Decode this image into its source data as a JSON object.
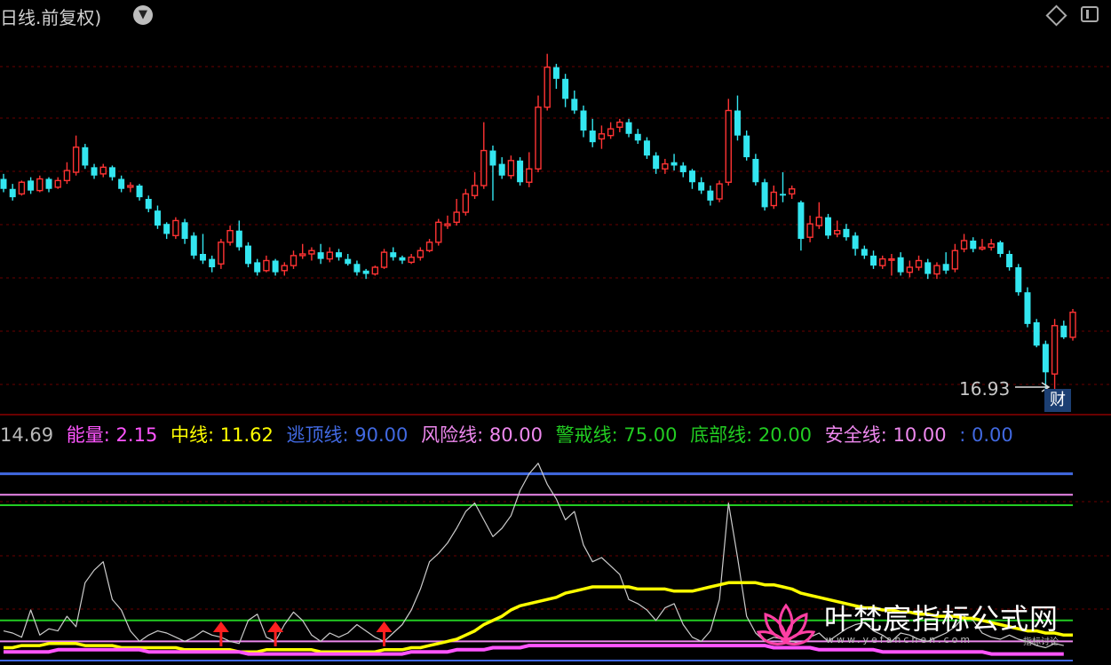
{
  "header": {
    "title": "日线.前复权)",
    "dropdown_icon": "chevron-down-icon"
  },
  "toolbar": {
    "diamond_icon": "diamond-icon",
    "panel_icon": "panel-layout-icon"
  },
  "price": {
    "low_label": "16.93",
    "badge": "财"
  },
  "legend": {
    "scale": "14.69",
    "items": [
      {
        "label": "能量",
        "value": "2.15",
        "color": "#ff55ff"
      },
      {
        "label": "中线",
        "value": "11.62",
        "color": "#ffff00"
      },
      {
        "label": "逃顶线",
        "value": "90.00",
        "color": "#4169e1"
      },
      {
        "label": "风险线",
        "value": "80.00",
        "color": "#ee88ee"
      },
      {
        "label": "警戒线",
        "value": "75.00",
        "color": "#22cc22"
      },
      {
        "label": "底部线",
        "value": "20.00",
        "color": "#22cc22"
      },
      {
        "label": "安全线",
        "value": "10.00",
        "color": "#ee88ee"
      },
      {
        "label": "",
        "value": "0.00",
        "color": "#4169e1"
      }
    ]
  },
  "watermark": {
    "title": "叶梵宸指标公式网",
    "subtitle": "www.yefanchen.com",
    "subtitle2": "指标讨论"
  },
  "chart_data": [
    {
      "type": "candlestick",
      "colors": {
        "up": "#ff3333",
        "down": "#33e6f0"
      },
      "low_marker": 16.93,
      "candles": [
        [
          18.2,
          17.6,
          18.5,
          17.4
        ],
        [
          17.6,
          17.1,
          17.9,
          16.9
        ],
        [
          17.3,
          18.0,
          18.1,
          17.2
        ],
        [
          18.1,
          17.5,
          18.3,
          17.3
        ],
        [
          17.5,
          18.2,
          18.4,
          17.4
        ],
        [
          18.2,
          17.6,
          18.3,
          17.4
        ],
        [
          17.7,
          18.1,
          18.3,
          17.6
        ],
        [
          18.1,
          18.7,
          19.2,
          17.9
        ],
        [
          18.6,
          20.1,
          20.8,
          18.4
        ],
        [
          20.1,
          19.0,
          20.3,
          18.8
        ],
        [
          18.9,
          18.4,
          19.1,
          18.2
        ],
        [
          18.5,
          18.9,
          19.1,
          18.3
        ],
        [
          18.9,
          18.3,
          19.0,
          18.1
        ],
        [
          18.2,
          17.6,
          18.4,
          17.4
        ],
        [
          17.7,
          17.8,
          18.0,
          17.4
        ],
        [
          17.8,
          17.1,
          17.9,
          16.9
        ],
        [
          17.0,
          16.4,
          17.2,
          16.2
        ],
        [
          16.3,
          15.4,
          16.6,
          15.2
        ],
        [
          15.5,
          14.9,
          15.6,
          14.6
        ],
        [
          14.8,
          15.7,
          15.9,
          14.6
        ],
        [
          15.6,
          14.6,
          15.8,
          14.3
        ],
        [
          14.8,
          13.6,
          15.0,
          13.4
        ],
        [
          13.7,
          13.3,
          14.9,
          13.1
        ],
        [
          13.4,
          12.9,
          13.6,
          12.6
        ],
        [
          13.1,
          14.4,
          14.6,
          12.8
        ],
        [
          14.4,
          15.1,
          15.4,
          14.2
        ],
        [
          15.1,
          14.1,
          15.7,
          13.9
        ],
        [
          14.2,
          13.1,
          14.4,
          12.9
        ],
        [
          13.2,
          12.6,
          13.4,
          12.4
        ],
        [
          12.7,
          13.3,
          13.6,
          12.6
        ],
        [
          13.3,
          12.6,
          13.4,
          12.4
        ],
        [
          12.7,
          13.0,
          13.2,
          12.4
        ],
        [
          13.0,
          13.6,
          13.9,
          12.8
        ],
        [
          13.6,
          13.7,
          14.3,
          13.4
        ],
        [
          13.7,
          13.9,
          14.1,
          13.3
        ],
        [
          13.8,
          13.4,
          14.3,
          13.1
        ],
        [
          13.4,
          13.8,
          14.1,
          13.2
        ],
        [
          13.8,
          13.5,
          14.0,
          13.3
        ],
        [
          13.4,
          13.1,
          13.7,
          13.0
        ],
        [
          13.1,
          12.6,
          13.3,
          12.4
        ],
        [
          12.7,
          12.5,
          12.8,
          12.2
        ],
        [
          12.5,
          12.9,
          13.0,
          12.4
        ],
        [
          12.9,
          13.8,
          14.0,
          12.8
        ],
        [
          13.8,
          13.5,
          14.1,
          13.3
        ],
        [
          13.5,
          13.3,
          13.6,
          13.1
        ],
        [
          13.2,
          13.5,
          13.7,
          13.1
        ],
        [
          13.5,
          13.9,
          14.1,
          13.3
        ],
        [
          13.9,
          14.4,
          14.6,
          13.8
        ],
        [
          14.4,
          15.6,
          15.8,
          14.2
        ],
        [
          15.4,
          15.5,
          16.0,
          15.2
        ],
        [
          15.6,
          16.2,
          17.0,
          15.4
        ],
        [
          16.2,
          17.3,
          17.6,
          16.0
        ],
        [
          17.2,
          17.8,
          18.6,
          17.0
        ],
        [
          17.8,
          19.9,
          21.6,
          17.6
        ],
        [
          19.9,
          19.0,
          20.2,
          16.9
        ],
        [
          19.1,
          18.4,
          19.5,
          18.2
        ],
        [
          18.4,
          19.3,
          19.6,
          18.2
        ],
        [
          19.3,
          18.0,
          19.5,
          17.8
        ],
        [
          18.0,
          18.8,
          19.8,
          17.7
        ],
        [
          18.8,
          22.5,
          23.2,
          18.6
        ],
        [
          22.5,
          24.9,
          25.7,
          22.3
        ],
        [
          24.9,
          24.2,
          25.1,
          23.6
        ],
        [
          24.2,
          23.0,
          24.5,
          22.5
        ],
        [
          23.0,
          22.3,
          23.5,
          22.1
        ],
        [
          22.3,
          21.1,
          22.6,
          20.7
        ],
        [
          21.1,
          20.4,
          21.8,
          20.1
        ],
        [
          20.6,
          20.9,
          21.4,
          20.0
        ],
        [
          20.8,
          21.2,
          21.6,
          20.6
        ],
        [
          21.3,
          21.6,
          21.8,
          21.0
        ],
        [
          21.6,
          20.9,
          21.8,
          20.7
        ],
        [
          20.9,
          20.5,
          21.2,
          20.3
        ],
        [
          20.5,
          19.6,
          20.7,
          19.4
        ],
        [
          19.6,
          18.8,
          19.8,
          18.5
        ],
        [
          18.8,
          19.1,
          19.4,
          18.5
        ],
        [
          19.2,
          19.0,
          19.7,
          18.7
        ],
        [
          19.0,
          18.6,
          19.2,
          18.3
        ],
        [
          18.7,
          18.0,
          18.8,
          17.6
        ],
        [
          18.0,
          17.5,
          18.3,
          17.3
        ],
        [
          17.5,
          16.9,
          17.8,
          16.6
        ],
        [
          17.0,
          17.9,
          18.1,
          16.8
        ],
        [
          18.0,
          22.3,
          23.0,
          17.8
        ],
        [
          22.3,
          20.8,
          23.2,
          20.5
        ],
        [
          20.8,
          19.5,
          21.1,
          19.3
        ],
        [
          19.4,
          18.0,
          19.7,
          17.8
        ],
        [
          18.0,
          16.5,
          18.2,
          16.3
        ],
        [
          16.6,
          17.4,
          17.8,
          16.4
        ],
        [
          17.3,
          17.2,
          18.6,
          16.8
        ],
        [
          17.3,
          17.6,
          17.8,
          17.0
        ],
        [
          16.8,
          14.6,
          16.9,
          13.9
        ],
        [
          14.7,
          15.5,
          16.0,
          14.4
        ],
        [
          15.4,
          15.9,
          16.8,
          15.2
        ],
        [
          15.9,
          14.8,
          16.1,
          14.6
        ],
        [
          14.9,
          15.1,
          15.7,
          14.7
        ],
        [
          15.2,
          14.7,
          15.5,
          14.5
        ],
        [
          14.8,
          14.0,
          15.0,
          13.6
        ],
        [
          14.0,
          13.6,
          14.2,
          13.4
        ],
        [
          13.6,
          13.0,
          13.9,
          12.8
        ],
        [
          13.0,
          13.4,
          13.6,
          12.8
        ],
        [
          13.4,
          13.4,
          13.7,
          12.4
        ],
        [
          13.5,
          12.6,
          13.8,
          12.4
        ],
        [
          12.6,
          12.9,
          13.3,
          12.3
        ],
        [
          12.9,
          13.3,
          13.6,
          12.7
        ],
        [
          13.2,
          12.5,
          13.4,
          12.2
        ],
        [
          12.5,
          13.0,
          13.2,
          12.2
        ],
        [
          13.1,
          12.7,
          13.8,
          12.5
        ],
        [
          12.8,
          13.9,
          14.3,
          12.6
        ],
        [
          14.0,
          14.5,
          14.9,
          13.8
        ],
        [
          14.5,
          14.0,
          14.7,
          13.8
        ],
        [
          14.0,
          14.1,
          14.6,
          13.9
        ],
        [
          14.1,
          14.3,
          14.6,
          13.9
        ],
        [
          14.4,
          13.7,
          14.5,
          13.5
        ],
        [
          13.7,
          12.9,
          13.9,
          12.7
        ],
        [
          12.9,
          11.4,
          13.1,
          11.2
        ],
        [
          11.4,
          9.5,
          11.7,
          9.3
        ],
        [
          9.6,
          8.2,
          9.8,
          8.1
        ],
        [
          8.3,
          6.6,
          8.5,
          5.6
        ],
        [
          6.5,
          9.4,
          9.8,
          5.6
        ],
        [
          9.4,
          8.7,
          9.7,
          8.6
        ],
        [
          8.7,
          10.2,
          10.4,
          8.5
        ]
      ]
    },
    {
      "type": "line",
      "ylim": [
        0,
        100
      ],
      "hlines": [
        {
          "name": "逃顶线",
          "value": 90,
          "color": "#4169e1"
        },
        {
          "name": "风险线",
          "value": 80,
          "color": "#ee88ee"
        },
        {
          "name": "警戒线",
          "value": 75,
          "color": "#22cc22"
        },
        {
          "name": "底部线",
          "value": 20,
          "color": "#22cc22"
        },
        {
          "name": "安全线",
          "value": 10,
          "color": "#ee88ee"
        },
        {
          "name": "",
          "value": 0,
          "color": "#4169e1"
        }
      ],
      "series": [
        {
          "name": "能量",
          "color": "#cccccc",
          "values": [
            15,
            14,
            12,
            25,
            13,
            16,
            15,
            22,
            17,
            38,
            44,
            48,
            30,
            25,
            15,
            10,
            13,
            15,
            14,
            12,
            10,
            12,
            15,
            13,
            12,
            10,
            9,
            20,
            23,
            12,
            10,
            18,
            24,
            20,
            13,
            10,
            14,
            12,
            14,
            18,
            15,
            12,
            10,
            14,
            18,
            25,
            35,
            48,
            52,
            57,
            64,
            72,
            76,
            68,
            60,
            64,
            70,
            82,
            90,
            95,
            85,
            78,
            68,
            72,
            56,
            48,
            50,
            46,
            42,
            30,
            28,
            25,
            20,
            26,
            28,
            18,
            12,
            10,
            15,
            30,
            76,
            50,
            22,
            14,
            10,
            12,
            11,
            10,
            9,
            12,
            14,
            10,
            13,
            16,
            18,
            19,
            15,
            13,
            10,
            14,
            13,
            11,
            10,
            12,
            14,
            17,
            22,
            20,
            14,
            12,
            11,
            13,
            11,
            10,
            8,
            7,
            9,
            8
          ]
        },
        {
          "name": "中线",
          "color": "#ffff00",
          "values": [
            7,
            7,
            8,
            8,
            8,
            9,
            9,
            9,
            9,
            8,
            8,
            8,
            8,
            7,
            7,
            7,
            7,
            7,
            7,
            7,
            6,
            6,
            6,
            6,
            6,
            6,
            5,
            5,
            5,
            6,
            6,
            6,
            6,
            6,
            6,
            5,
            5,
            5,
            5,
            5,
            5,
            5,
            6,
            6,
            6,
            7,
            7,
            8,
            9,
            10,
            11,
            13,
            15,
            18,
            20,
            22,
            25,
            27,
            28,
            29,
            30,
            31,
            33,
            34,
            35,
            36,
            36,
            36,
            36,
            36,
            35,
            35,
            35,
            35,
            34,
            34,
            34,
            35,
            36,
            37,
            38,
            38,
            38,
            38,
            37,
            37,
            36,
            35,
            33,
            32,
            31,
            30,
            29,
            28,
            27,
            26,
            26,
            25,
            25,
            24,
            24,
            23,
            23,
            22,
            22,
            22,
            21,
            21,
            20,
            19,
            18,
            17,
            16,
            15,
            15,
            14,
            14,
            13,
            13
          ]
        },
        {
          "name": "能量带",
          "color": "#ff55ff",
          "values": [
            5,
            5,
            5,
            5,
            5,
            5,
            6,
            6,
            6,
            6,
            6,
            6,
            6,
            6,
            6,
            6,
            5,
            5,
            5,
            5,
            5,
            5,
            5,
            5,
            5,
            5,
            5,
            4,
            4,
            4,
            4,
            4,
            4,
            4,
            4,
            4,
            4,
            4,
            4,
            4,
            4,
            4,
            4,
            4,
            4,
            5,
            5,
            5,
            5,
            5,
            6,
            6,
            6,
            6,
            7,
            7,
            7,
            7,
            8,
            8,
            8,
            8,
            8,
            8,
            8,
            8,
            8,
            8,
            8,
            8,
            8,
            8,
            8,
            8,
            8,
            8,
            8,
            8,
            8,
            8,
            8,
            8,
            8,
            8,
            8,
            7,
            7,
            7,
            7,
            7,
            6,
            6,
            6,
            6,
            6,
            6,
            6,
            5,
            5,
            5,
            5,
            5,
            5,
            5,
            5,
            5,
            5,
            5,
            5,
            4,
            4,
            4,
            4,
            4,
            4,
            4,
            4,
            4
          ]
        }
      ],
      "signals": {
        "name": "up-arrow",
        "color": "#ff2020",
        "x_index": [
          24,
          30,
          42
        ]
      }
    }
  ]
}
